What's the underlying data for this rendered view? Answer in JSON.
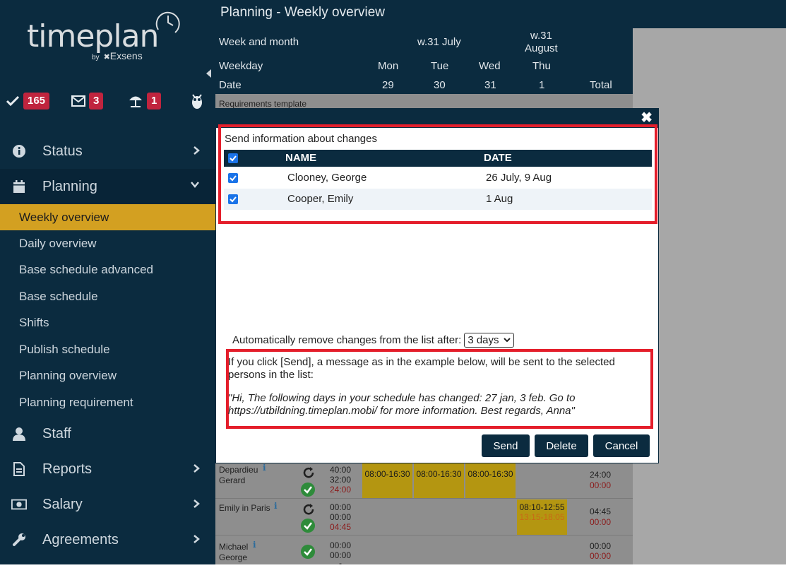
{
  "app": {
    "logo_text": "timeplan",
    "logo_by": "by",
    "logo_vendor": "Exsens"
  },
  "stats": {
    "tasks_count": "165",
    "messages_count": "3",
    "absence_count": "1"
  },
  "sidebar": {
    "items": [
      {
        "label": "Status"
      },
      {
        "label": "Planning"
      },
      {
        "label": "Staff"
      },
      {
        "label": "Reports"
      },
      {
        "label": "Salary"
      },
      {
        "label": "Agreements"
      }
    ],
    "planning_sub": [
      {
        "label": "Weekly overview"
      },
      {
        "label": "Daily overview"
      },
      {
        "label": "Base schedule advanced"
      },
      {
        "label": "Base schedule"
      },
      {
        "label": "Shifts"
      },
      {
        "label": "Publish schedule"
      },
      {
        "label": "Planning overview"
      },
      {
        "label": "Planning requirement"
      }
    ]
  },
  "page": {
    "title": "Planning - Weekly overview"
  },
  "table": {
    "row_labels": [
      "Week and month",
      "Weekday",
      "Date"
    ],
    "week_july": "w.31 July",
    "week_aug_line1": "w.31",
    "week_aug_line2": "August",
    "days": [
      "Mon",
      "Tue",
      "Wed",
      "Thu"
    ],
    "dates": [
      "29",
      "30",
      "31",
      "1"
    ],
    "total_label": "Total",
    "requirements_label": "Requirements template",
    "rows": [
      {
        "name_line1": "Depardieu",
        "name_line2": "Gerard",
        "h1": "40:00",
        "h2": "32:00",
        "h3": "24:00",
        "shifts": [
          "08:00-16:30",
          "08:00-16:30",
          "08:00-16:30"
        ],
        "total1": "24:00",
        "total2": "00:00"
      },
      {
        "name_line1": "Emily in Paris",
        "name_line2": "",
        "h1": "00:00",
        "h2": "00:00",
        "h3": "04:45",
        "shift_thu_1": "08:10-12:55",
        "shift_thu_2": "13:15-18:05",
        "total1": "04:45",
        "total2": "00:00"
      },
      {
        "name_line1": "Michael",
        "name_line2": "George",
        "h1": "00:00",
        "h2": "00:00",
        "h3": "-",
        "total1": "00:00",
        "total2": "00:00"
      }
    ]
  },
  "modal": {
    "section_title": "Send information about changes",
    "col_name": "NAME",
    "col_date": "DATE",
    "rows": [
      {
        "name": "Clooney, George",
        "date": "26 July, 9 Aug",
        "checked": true
      },
      {
        "name": "Cooper, Emily",
        "date": "1 Aug",
        "checked": true
      }
    ],
    "auto_remove_label": "Automatically remove changes from the list after:",
    "auto_remove_value": "3 days",
    "info_text": "If you click [Send], a message as in the example below, will be sent to the selected persons in the list:",
    "example_text": "\"Hi, The following days in your schedule has changed: 27 jan, 3 feb. Go to https://utbildning.timeplan.mobi/ for more information. Best regards, Anna\"",
    "send_label": "Send",
    "delete_label": "Delete",
    "cancel_label": "Cancel",
    "close_symbol": "✖"
  },
  "colors": {
    "sidebar_bg": "#0b2b3f",
    "accent_gold": "#d3a021",
    "badge_red": "#c0243e",
    "highlight_red": "#e41e2b"
  }
}
